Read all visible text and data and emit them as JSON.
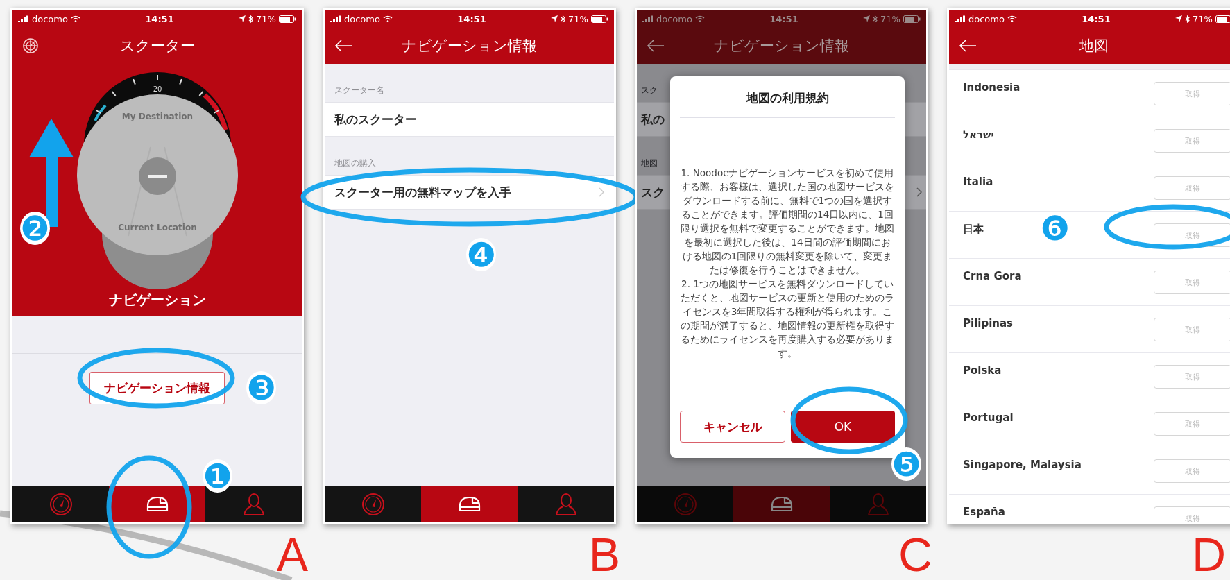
{
  "screens": [
    {
      "kind": "home",
      "caption": "A",
      "status": {
        "carrier": "docomo",
        "time": "14:51",
        "battery": "71%"
      },
      "title": "スクーター",
      "dial": {
        "tick": "20",
        "top_label": "My Destination",
        "bottom_label": "Current Location"
      },
      "mode_label": "ナビゲーション",
      "info_button": "ナビゲーション情報",
      "tabs": [
        {
          "selected": false
        },
        {
          "selected": true
        },
        {
          "selected": false
        }
      ],
      "markers": [
        "❶",
        "❷",
        "❸"
      ]
    },
    {
      "kind": "info",
      "caption": "B",
      "status": {
        "carrier": "docomo",
        "time": "14:51",
        "battery": "71%"
      },
      "title": "ナビゲーション情報",
      "sections": [
        {
          "header": "スクーター名",
          "row": "私のスクーター",
          "chevron": false
        },
        {
          "header": "地図の購入",
          "row": "スクーター用の無料マップを入手",
          "chevron": true
        }
      ],
      "tabs": [
        {
          "selected": false
        },
        {
          "selected": true
        },
        {
          "selected": false
        }
      ],
      "markers": [
        "❹"
      ]
    },
    {
      "kind": "terms",
      "caption": "C",
      "status": {
        "carrier": "docomo",
        "time": "14:51",
        "battery": "71%"
      },
      "title": "ナビゲーション情報",
      "sections": [
        {
          "header": "スク",
          "row": "私の",
          "chevron": false
        },
        {
          "header": "地図",
          "row": "スク",
          "chevron": true
        }
      ],
      "dialog": {
        "title": "地図の利用規約",
        "paragraphs": [
          "1. Noodoeナビゲーションサービスを初めて使用する際、お客様は、選択した国の地図サービスをダウンロードする前に、無料で1つの国を選択することができます。評価期間の14日以内に、1回限り選択を無料で変更することができます。地図を最初に選択した後は、14日間の評価期間における地図の1回限りの無料変更を除いて、変更または修復を行うことはできません。",
          "2. 1つの地図サービスを無料ダウンロードしていただくと、地図サービスの更新と使用のためのライセンスを3年間取得する権利が得られます。この期間が満了すると、地図情報の更新権を取得するためにライセンスを再度購入する必要があります。"
        ],
        "cancel": "キャンセル",
        "ok": "OK"
      },
      "tabs": [
        {
          "selected": false
        },
        {
          "selected": true
        },
        {
          "selected": false
        }
      ],
      "markers": [
        "❺"
      ]
    },
    {
      "kind": "maps",
      "caption": "D",
      "status": {
        "carrier": "docomo",
        "time": "14:51",
        "battery": "71%"
      },
      "title": "地図",
      "countries": [
        {
          "name": "Indonesia",
          "action": "取得"
        },
        {
          "name": "ישראל",
          "action": "取得"
        },
        {
          "name": "Italia",
          "action": "取得"
        },
        {
          "name": "日本",
          "action": "取得"
        },
        {
          "name": "Crna Gora",
          "action": "取得"
        },
        {
          "name": "Pilipinas",
          "action": "取得"
        },
        {
          "name": "Polska",
          "action": "取得"
        },
        {
          "name": "Portugal",
          "action": "取得"
        },
        {
          "name": "Singapore, Malaysia",
          "action": "取得"
        },
        {
          "name": "España",
          "action": "取得"
        }
      ],
      "markers": [
        "❻"
      ]
    }
  ]
}
